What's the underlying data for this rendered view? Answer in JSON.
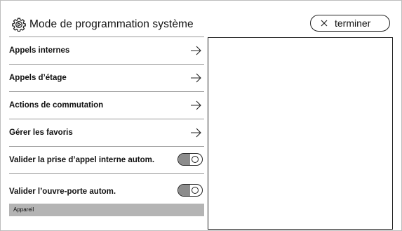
{
  "header": {
    "title": "Mode de programmation système",
    "icon": "settings-gear-icon",
    "finish_label": "terminer",
    "finish_icon": "close-icon"
  },
  "menu": {
    "items": [
      {
        "label": "Appels internes",
        "icon": "arrow-right-icon"
      },
      {
        "label": "Appels d’étage",
        "icon": "arrow-right-icon"
      },
      {
        "label": "Actions de commutation",
        "icon": "arrow-right-icon"
      },
      {
        "label": "Gérer les favoris",
        "icon": "arrow-right-icon"
      }
    ],
    "toggles": [
      {
        "label": "Valider la prise d’appel interne autom.",
        "state": "off"
      },
      {
        "label": "Valider l’ouvre-porte autom.",
        "state": "off"
      }
    ],
    "section_label": "Appareil"
  },
  "colors": {
    "border": "#222222",
    "divider": "#9a9a9a",
    "section_bg": "#b4b4b4",
    "toggle_fill": "#8c8c8c"
  }
}
